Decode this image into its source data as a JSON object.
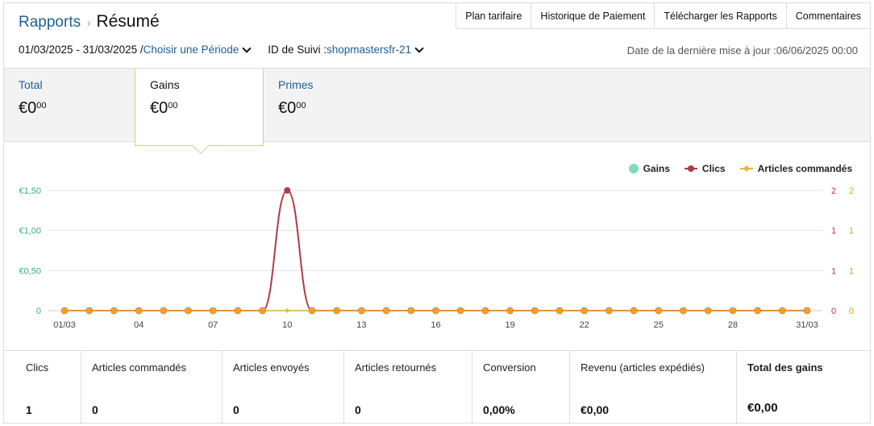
{
  "breadcrumb": {
    "parent": "Rapports",
    "separator": "›",
    "current": "Résumé"
  },
  "top_buttons": [
    "Plan tarifaire",
    "Historique de Paiement",
    "Télécharger les Rapports",
    "Commentaires"
  ],
  "filters": {
    "date_range": "01/03/2025 - 31/03/2025 /",
    "period_link": "Choisir une Période",
    "tracking_label": "ID de Suivi :",
    "tracking_value": "shopmastersfr-21",
    "last_update": "Date de la dernière mise à jour :06/06/2025 00:00"
  },
  "summary": [
    {
      "label": "Total",
      "currency": "€",
      "whole": "0",
      "cents": "00",
      "active": false
    },
    {
      "label": "Gains",
      "currency": "€",
      "whole": "0",
      "cents": "00",
      "active": true
    },
    {
      "label": "Primes",
      "currency": "€",
      "whole": "0",
      "cents": "00",
      "active": false
    }
  ],
  "chart_data": {
    "type": "line",
    "legend": [
      {
        "name": "Gains",
        "color": "#7fd9c0",
        "marker": "circle"
      },
      {
        "name": "Clics",
        "color": "#b23a48",
        "marker": "circle"
      },
      {
        "name": "Articles commandés",
        "color": "#e9b33b",
        "marker": "diamond"
      }
    ],
    "legend_position": "top-right",
    "x_categories": [
      "01/03",
      "02/03",
      "03/03",
      "04/03",
      "05/03",
      "06/03",
      "07/03",
      "08/03",
      "09/03",
      "10/03",
      "11/03",
      "12/03",
      "13/03",
      "14/03",
      "15/03",
      "16/03",
      "17/03",
      "18/03",
      "19/03",
      "20/03",
      "21/03",
      "22/03",
      "23/03",
      "24/03",
      "25/03",
      "26/03",
      "27/03",
      "28/03",
      "29/03",
      "30/03",
      "31/03"
    ],
    "x_tick_labels": [
      {
        "index": 0,
        "label": "01/03"
      },
      {
        "index": 3,
        "label": "04"
      },
      {
        "index": 6,
        "label": "07"
      },
      {
        "index": 9,
        "label": "10"
      },
      {
        "index": 12,
        "label": "13"
      },
      {
        "index": 15,
        "label": "16"
      },
      {
        "index": 18,
        "label": "19"
      },
      {
        "index": 21,
        "label": "22"
      },
      {
        "index": 24,
        "label": "25"
      },
      {
        "index": 27,
        "label": "28"
      },
      {
        "index": 30,
        "label": "31/03"
      }
    ],
    "y_left": {
      "ticks": [
        0,
        0.5,
        1.0,
        1.5
      ],
      "labels": [
        "0",
        "€0,50",
        "€1,00",
        "€1,50"
      ],
      "range": [
        0,
        1.5
      ],
      "color": "#3aa889"
    },
    "y_right_clics": {
      "labels": [
        "0",
        "1",
        "1",
        "2"
      ],
      "range": [
        0,
        2
      ],
      "color": "#b23a48"
    },
    "y_right_articles": {
      "labels": [
        "0",
        "1",
        "1",
        "2"
      ],
      "range": [
        0,
        2
      ],
      "color": "#d9a020"
    },
    "grid": true,
    "series": [
      {
        "name": "Gains",
        "color": "#7fd9c0",
        "values": [
          0,
          0,
          0,
          0,
          0,
          0,
          0,
          0,
          0,
          0,
          0,
          0,
          0,
          0,
          0,
          0,
          0,
          0,
          0,
          0,
          0,
          0,
          0,
          0,
          0,
          0,
          0,
          0,
          0,
          0,
          0
        ]
      },
      {
        "name": "Clics",
        "color": "#b23a48",
        "values": [
          0,
          0,
          0,
          0,
          0,
          0,
          0,
          0,
          0,
          2,
          0,
          0,
          0,
          0,
          0,
          0,
          0,
          0,
          0,
          0,
          0,
          0,
          0,
          0,
          0,
          0,
          0,
          0,
          0,
          0,
          0
        ]
      },
      {
        "name": "Articles commandés",
        "color": "#e9b33b",
        "values": [
          0,
          0,
          0,
          0,
          0,
          0,
          0,
          0,
          0,
          0,
          0,
          0,
          0,
          0,
          0,
          0,
          0,
          0,
          0,
          0,
          0,
          0,
          0,
          0,
          0,
          0,
          0,
          0,
          0,
          0,
          0
        ]
      }
    ]
  },
  "stats": [
    {
      "label": "Clics",
      "value": "1"
    },
    {
      "label": "Articles commandés",
      "value": "0"
    },
    {
      "label": "Articles envoyés",
      "value": "0"
    },
    {
      "label": "Articles retournés",
      "value": "0"
    },
    {
      "label": "Conversion",
      "value": "0,00%"
    },
    {
      "label": "Revenu (articles expédiés)",
      "value": "€0,00"
    },
    {
      "label": "Total des gains",
      "value": "€0,00"
    }
  ]
}
